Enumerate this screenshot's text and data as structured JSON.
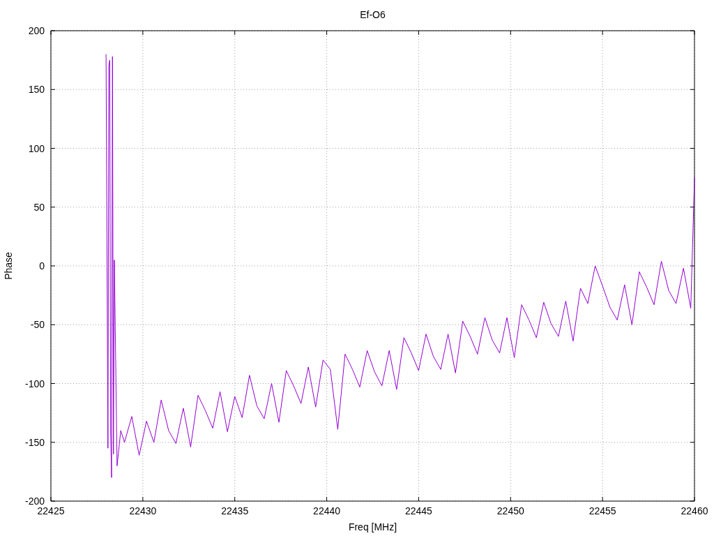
{
  "chart_data": {
    "type": "line",
    "grid": true,
    "title": "Ef-O6",
    "xlabel": "Freq [MHz]",
    "ylabel": "Phase",
    "xlim": [
      22425,
      22460
    ],
    "ylim": [
      -200,
      200
    ],
    "xticks": [
      22425,
      22430,
      22435,
      22440,
      22445,
      22450,
      22455,
      22460
    ],
    "yticks": [
      -200,
      -150,
      -100,
      -50,
      0,
      50,
      100,
      150,
      200
    ],
    "x": [
      22428.0,
      22428.1,
      22428.15,
      22428.2,
      22428.25,
      22428.3,
      22428.35,
      22428.4,
      22428.45,
      22428.6,
      22428.8,
      22429.0,
      22429.4,
      22429.8,
      22430.2,
      22430.6,
      22431.0,
      22431.4,
      22431.8,
      22432.2,
      22432.6,
      22433.0,
      22433.4,
      22433.8,
      22434.2,
      22434.6,
      22435.0,
      22435.4,
      22435.8,
      22436.2,
      22436.6,
      22437.0,
      22437.4,
      22437.8,
      22438.2,
      22438.6,
      22439.0,
      22439.4,
      22439.8,
      22440.2,
      22440.6,
      22441.0,
      22441.4,
      22441.8,
      22442.2,
      22442.6,
      22443.0,
      22443.4,
      22443.8,
      22444.2,
      22444.6,
      22445.0,
      22445.4,
      22445.8,
      22446.2,
      22446.6,
      22447.0,
      22447.4,
      22447.8,
      22448.2,
      22448.6,
      22449.0,
      22449.4,
      22449.8,
      22450.2,
      22450.6,
      22451.0,
      22451.4,
      22451.8,
      22452.2,
      22452.6,
      22453.0,
      22453.4,
      22453.8,
      22454.2,
      22454.6,
      22455.0,
      22455.4,
      22455.8,
      22456.2,
      22456.6,
      22457.0,
      22457.4,
      22457.8,
      22458.2,
      22458.6,
      22459.0,
      22459.4,
      22459.8,
      22460.0
    ],
    "series": [
      {
        "color": "#9400d3",
        "values": [
          180,
          -155,
          170,
          175,
          -140,
          -180,
          178,
          -160,
          5,
          -170,
          -140,
          -150,
          -128,
          -161,
          -132,
          -150,
          -114,
          -140,
          -151,
          -121,
          -154,
          -110,
          -123,
          -138,
          -107,
          -141,
          -111,
          -129,
          -93,
          -119,
          -130,
          -100,
          -133,
          -89,
          -102,
          -117,
          -86,
          -120,
          -80,
          -88,
          -139,
          -75,
          -88,
          -103,
          -72,
          -90,
          -102,
          -72,
          -105,
          -61,
          -74,
          -89,
          -58,
          -77,
          -88,
          -58,
          -91,
          -47,
          -60,
          -75,
          -44,
          -63,
          -74,
          -44,
          -78,
          -33,
          -46,
          -61,
          -31,
          -49,
          -60,
          -30,
          -64,
          -19,
          -32,
          0,
          -17,
          -35,
          -46,
          -16,
          -50,
          -5,
          -18,
          -33,
          4,
          -21,
          -32,
          -2,
          -36,
          75
        ]
      }
    ]
  }
}
